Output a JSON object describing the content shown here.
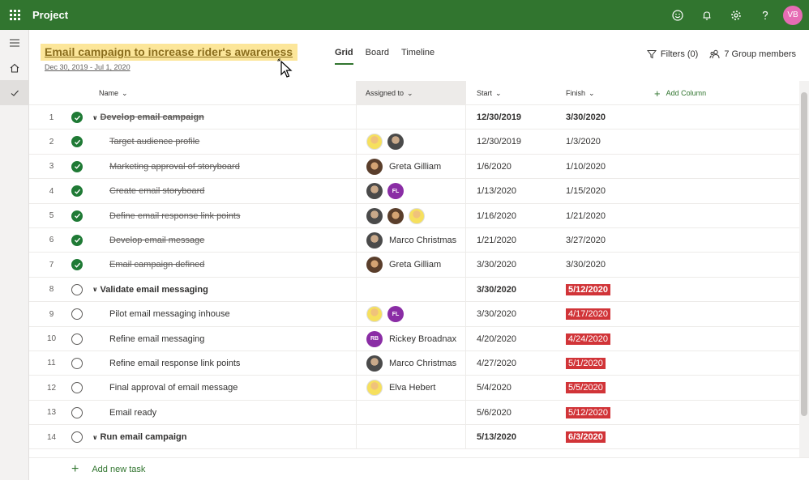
{
  "app": {
    "name": "Project",
    "user_initials": "VB",
    "accent": "#31752f"
  },
  "header": {
    "title": "Email campaign to increase rider's awareness",
    "date_range": "Dec 30, 2019 - Jul 1, 2020",
    "views": [
      "Grid",
      "Board",
      "Timeline"
    ],
    "active_view": "Grid",
    "filters_label": "Filters (0)",
    "members_label": "7 Group members"
  },
  "columns": {
    "name": "Name",
    "assigned": "Assigned to",
    "start": "Start",
    "finish": "Finish",
    "add": "Add Column"
  },
  "tasks": [
    {
      "num": "1",
      "name": "Develop email campaign",
      "start": "12/30/2019",
      "finish": "3/30/2020",
      "done": true,
      "summary": true
    },
    {
      "num": "2",
      "name": "Target audience profile",
      "start": "12/30/2019",
      "finish": "1/3/2020",
      "done": true,
      "avatars": [
        "a",
        "b"
      ]
    },
    {
      "num": "3",
      "name": "Marketing approval of storyboard",
      "start": "1/6/2020",
      "finish": "1/10/2020",
      "done": true,
      "avatars": [
        "c"
      ],
      "assignee": "Greta Gilliam"
    },
    {
      "num": "4",
      "name": "Create email storyboard",
      "start": "1/13/2020",
      "finish": "1/15/2020",
      "done": true,
      "avatars": [
        "b",
        "FL"
      ]
    },
    {
      "num": "5",
      "name": "Define email response link points",
      "start": "1/16/2020",
      "finish": "1/21/2020",
      "done": true,
      "avatars": [
        "b",
        "c",
        "a"
      ]
    },
    {
      "num": "6",
      "name": "Develop email message",
      "start": "1/21/2020",
      "finish": "3/27/2020",
      "done": true,
      "avatars": [
        "b"
      ],
      "assignee": "Marco Christmas"
    },
    {
      "num": "7",
      "name": "Email campaign defined",
      "start": "3/30/2020",
      "finish": "3/30/2020",
      "done": true,
      "avatars": [
        "c"
      ],
      "assignee": "Greta Gilliam"
    },
    {
      "num": "8",
      "name": "Validate email messaging",
      "start": "3/30/2020",
      "finish": "5/12/2020",
      "done": false,
      "summary": true,
      "late": true
    },
    {
      "num": "9",
      "name": "Pilot email messaging inhouse",
      "start": "3/30/2020",
      "finish": "4/17/2020",
      "done": false,
      "avatars": [
        "a",
        "FL"
      ],
      "late": true
    },
    {
      "num": "10",
      "name": "Refine email messaging",
      "start": "4/20/2020",
      "finish": "4/24/2020",
      "done": false,
      "avatars": [
        "RB"
      ],
      "assignee": "Rickey Broadnax",
      "late": true
    },
    {
      "num": "11",
      "name": "Refine email response link points",
      "start": "4/27/2020",
      "finish": "5/1/2020",
      "done": false,
      "avatars": [
        "b"
      ],
      "assignee": "Marco Christmas",
      "late": true
    },
    {
      "num": "12",
      "name": "Final approval of email message",
      "start": "5/4/2020",
      "finish": "5/5/2020",
      "done": false,
      "avatars": [
        "a"
      ],
      "assignee": "Elva Hebert",
      "late": true
    },
    {
      "num": "13",
      "name": "Email ready",
      "start": "5/6/2020",
      "finish": "5/12/2020",
      "done": false,
      "late": true
    },
    {
      "num": "14",
      "name": "Run email campaign",
      "start": "5/13/2020",
      "finish": "6/3/2020",
      "done": false,
      "summary": true,
      "late": true
    }
  ],
  "footer": {
    "add_task": "Add new task"
  }
}
